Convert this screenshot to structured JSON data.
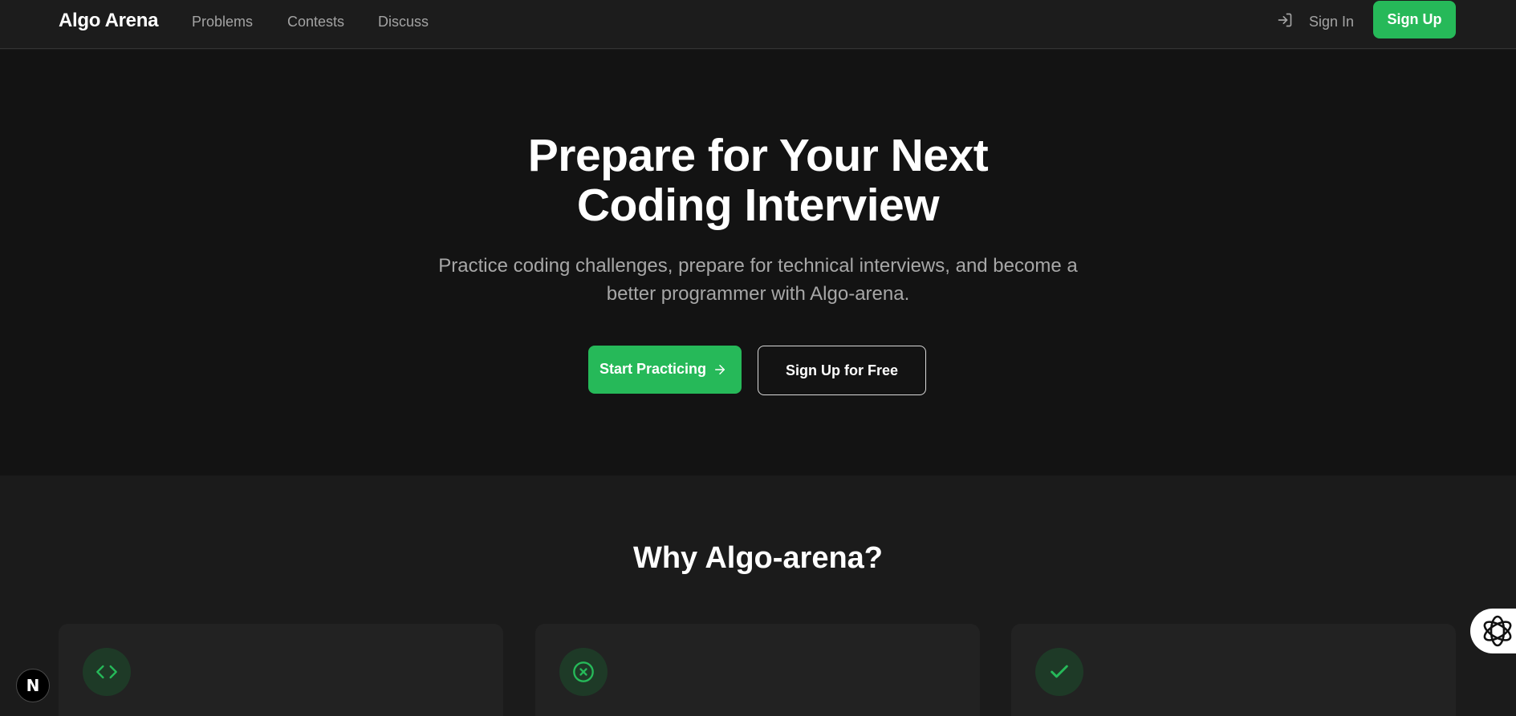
{
  "nav": {
    "brand": "Algo Arena",
    "links": [
      "Problems",
      "Contests",
      "Discuss"
    ],
    "sign_in": "Sign In",
    "sign_up": "Sign Up",
    "sign_in_icon": "log-in-icon"
  },
  "hero": {
    "title_line1": "Prepare for Your Next",
    "title_line2": "Coding Interview",
    "subtitle_line1": "Practice coding challenges, prepare for technical interviews, and become a",
    "subtitle_line2": "better programmer with Algo-arena.",
    "primary_button": "Start Practicing",
    "primary_button_icon": "arrow-right-icon",
    "secondary_button": "Sign Up for Free"
  },
  "why": {
    "title": "Why Algo-arena?",
    "cards": [
      {
        "icon": "code-icon"
      },
      {
        "icon": "x-circle-icon"
      },
      {
        "icon": "check-icon"
      }
    ]
  },
  "widgets": {
    "next_badge": "N",
    "side_widget_icon": "openai-logo-icon"
  },
  "colors": {
    "accent": "#26b959",
    "background": "#1b1b1b",
    "hero_background": "#131313",
    "card_background": "#222222"
  }
}
